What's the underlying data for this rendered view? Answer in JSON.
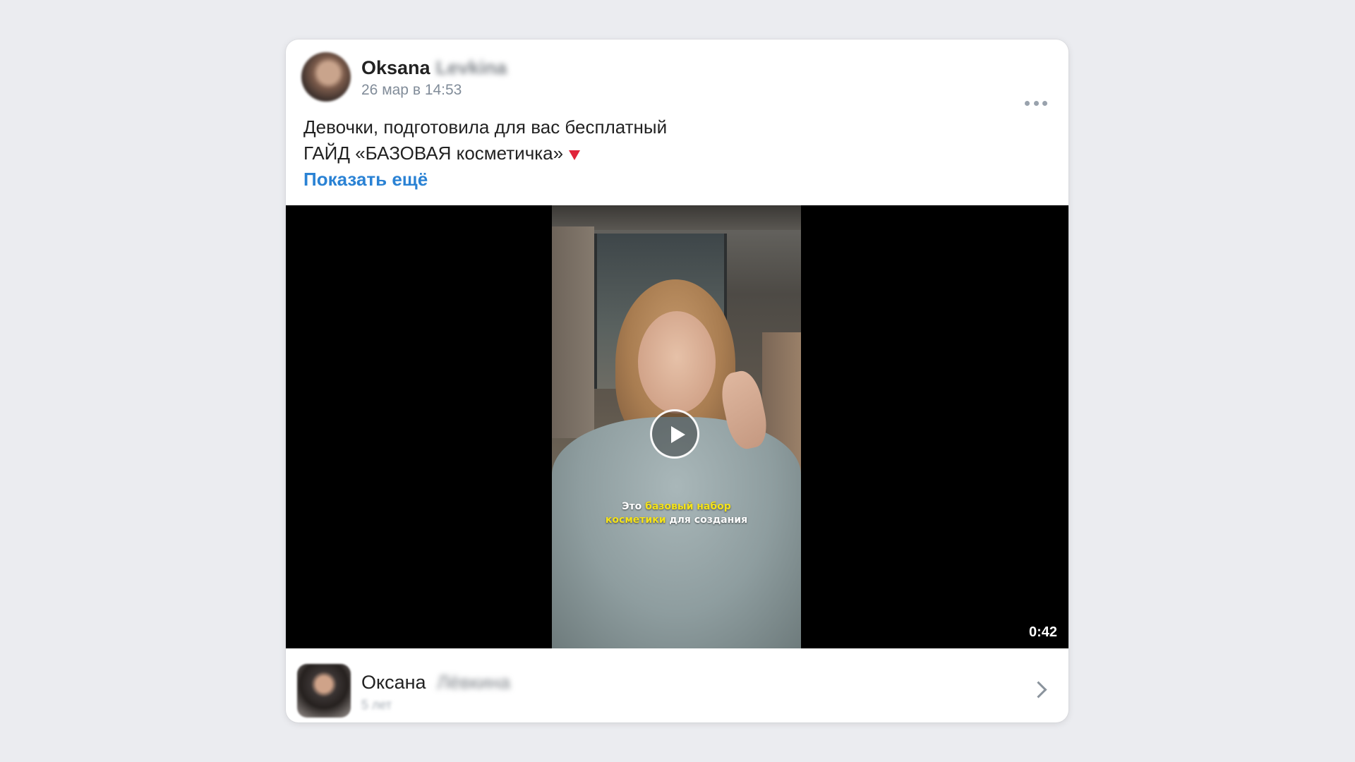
{
  "post": {
    "author_first": "Oksana",
    "author_last_blurred": "Levkina",
    "time": "26 мар в 14:53",
    "text_line1": "Девочки, подготовила для вас бесплатный",
    "text_line2": "ГАЙД «БАЗОВАЯ косметичка»",
    "show_more": "Показать ещё",
    "more_icon": "more-horizontal-icon",
    "emoji_icon": "red-triangle-down-icon"
  },
  "video": {
    "caption_word1": "Это",
    "caption_hl1": "базовый набор",
    "caption_hl2": "косметики",
    "caption_rest": "для создания",
    "duration": "0:42",
    "play_icon": "play-icon",
    "caption_highlight_color": "#f4e21a"
  },
  "footer": {
    "name_first": "Оксана",
    "name_last_blurred": "Лёвкина",
    "subtitle_blurred": "5 лет",
    "chevron_icon": "chevron-right-icon"
  },
  "colors": {
    "link": "#2a82d4",
    "background": "#ebecf0",
    "secondary_text": "#818c99"
  }
}
